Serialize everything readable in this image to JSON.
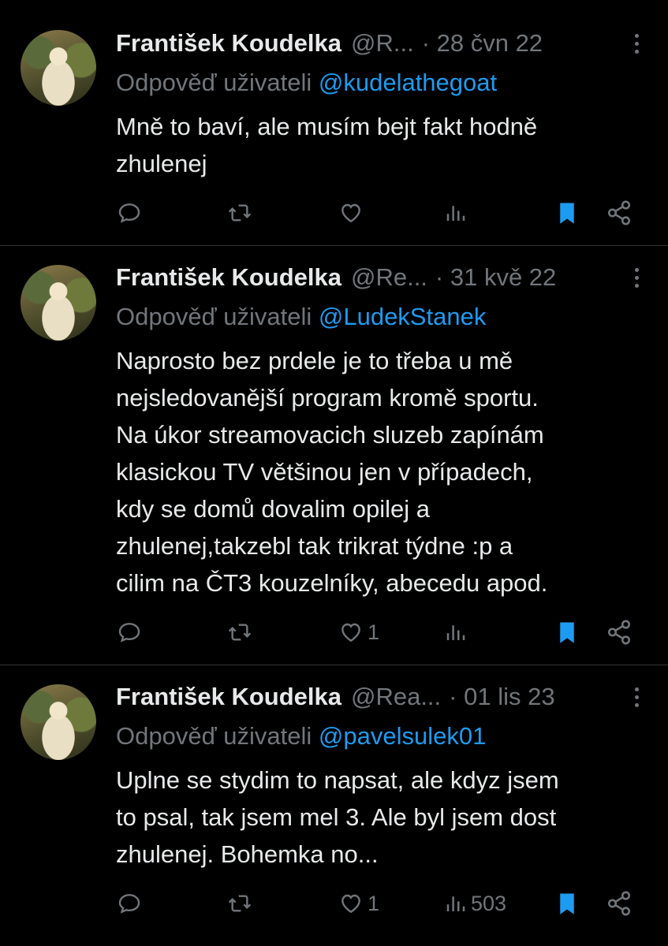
{
  "tweets": [
    {
      "name": "František Koudelka",
      "handle": "@R...",
      "date": "· 28 čvn 22",
      "reply_prefix": "Odpověď uživateli",
      "reply_to": "@kudelathegoat",
      "text": "Mně to baví, ale musím bejt fakt hodně\nzhulenej",
      "likes": "",
      "views": ""
    },
    {
      "name": "František Koudelka",
      "handle": "@Re...",
      "date": "· 31 kvě 22",
      "reply_prefix": "Odpověď uživateli",
      "reply_to": "@LudekStanek",
      "text": "Naprosto bez prdele je to třeba u mě\nnejsledovanější program kromě sportu.\nNa úkor streamovacich sluzeb zapínám\nklasickou TV většinou jen v případech,\nkdy se domů dovalim opilej a\nzhulenej,takzebl tak trikrat týdne :p a\ncilim na ČT3 kouzelníky, abecedu apod.",
      "likes": "1",
      "views": ""
    },
    {
      "name": "František Koudelka",
      "handle": "@Rea...",
      "date": "· 01 lis 23",
      "reply_prefix": "Odpověď uživateli",
      "reply_to": "@pavelsulek01",
      "text": "Uplne se stydim to napsat, ale kdyz jsem\nto psal, tak jsem mel 3. Ale byl jsem dost\nzhulenej. Bohemka no...",
      "likes": "1",
      "views": "503"
    }
  ],
  "icons": {
    "reply": "reply-icon",
    "retweet": "retweet-icon",
    "like": "heart-icon",
    "views": "views-icon",
    "bookmark": "bookmark-icon",
    "share": "share-icon",
    "more": "more-icon"
  },
  "colors": {
    "background": "#000000",
    "text": "#e7e9ea",
    "muted": "#71767b",
    "accent": "#1d9bf0",
    "divider": "#2f3336"
  }
}
